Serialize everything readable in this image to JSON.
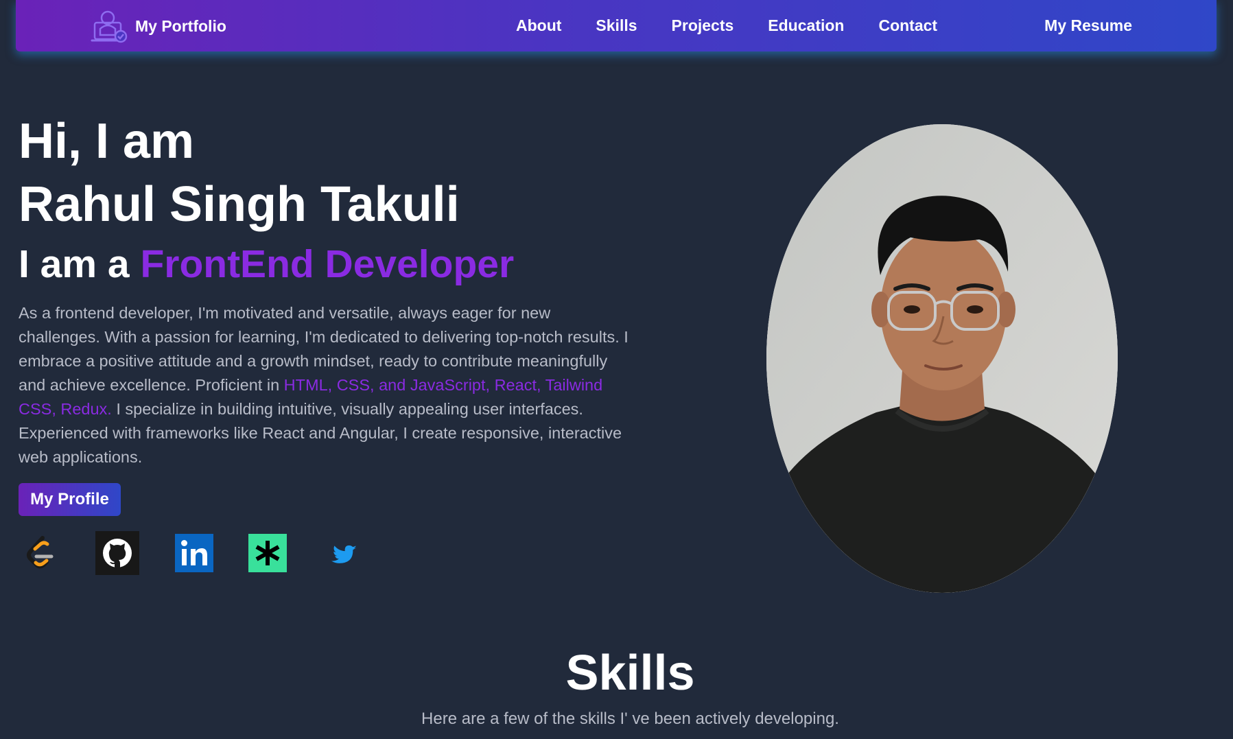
{
  "nav": {
    "brand": "My Portfolio",
    "brand_icon": "developer-laptop-icon",
    "links": [
      "About",
      "Skills",
      "Projects",
      "Education",
      "Contact"
    ],
    "resume": "My Resume",
    "close_icon": "close-icon"
  },
  "hero": {
    "greeting": "Hi, I am",
    "name": "Rahul Singh Takuli",
    "role_prefix": "I am a ",
    "role": "FrontEnd Developer",
    "bio_part1": "As a frontend developer, I'm motivated and versatile, always eager for new challenges. With a passion for learning, I'm dedicated to delivering top-notch results. I embrace a positive attitude and a growth mindset, ready to contribute meaningfully and achieve excellence. Proficient in ",
    "bio_highlight": "HTML, CSS, and JavaScript, React, Tailwind CSS, Redux.",
    "bio_part2": " I specialize in building intuitive, visually appealing user interfaces. Experienced with frameworks like React and Angular, I create responsive, interactive web applications.",
    "button": "My Profile",
    "photo_icon": "profile-photo"
  },
  "socials": [
    {
      "name": "leetcode-icon"
    },
    {
      "name": "github-icon"
    },
    {
      "name": "linkedin-icon"
    },
    {
      "name": "linktree-icon"
    },
    {
      "name": "twitter-icon"
    }
  ],
  "skills": {
    "title": "Skills",
    "subtitle": "Here are a few of the skills I' ve been actively developing."
  },
  "colors": {
    "background": "#212a3b",
    "accent_purple": "#8a2be2",
    "nav_gradient_start": "#6a22b8",
    "nav_gradient_end": "#2f47c8"
  }
}
